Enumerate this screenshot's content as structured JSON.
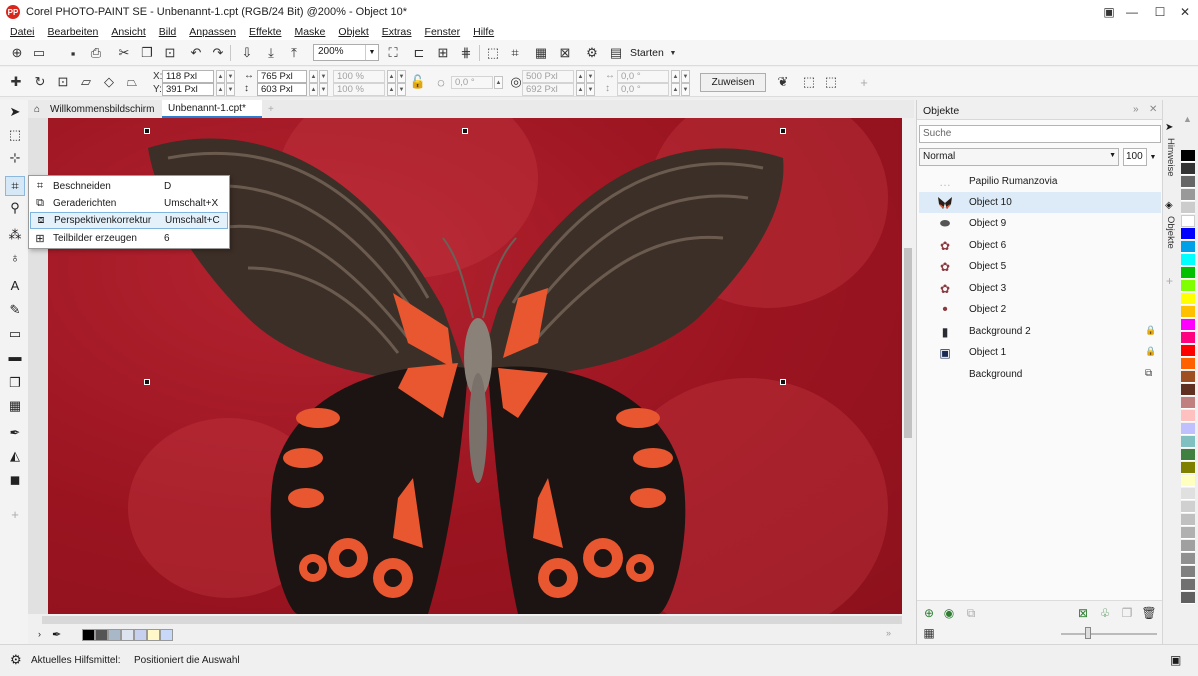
{
  "window": {
    "title": "Corel PHOTO-PAINT SE - Unbenannt-1.cpt (RGB/24 Bit) @200% - Object 10*",
    "app_icon_glyph": "PP",
    "minimize_glyph": "—",
    "maximize_glyph": "☐",
    "close_glyph": "✕"
  },
  "menu": [
    "Datei",
    "Bearbeiten",
    "Ansicht",
    "Bild",
    "Anpassen",
    "Effekte",
    "Maske",
    "Objekt",
    "Extras",
    "Fenster",
    "Hilfe"
  ],
  "toolbar": {
    "zoom_value": "200%",
    "zoom_arrow": "▼",
    "start_label": "Starten",
    "start_arrow": "▼"
  },
  "properties": {
    "x_label": "X:",
    "x_value": "118 Pxl",
    "y_label": "Y:",
    "y_value": "391 Pxl",
    "width_value": "765 Pxl",
    "height_value": "603 Pxl",
    "scale_w": "100 %",
    "scale_h": "100 %",
    "angle_value": "0,0 °",
    "center_x": "500 Pxl",
    "center_y": "692 Pxl",
    "skew_h": "0,0 °",
    "skew_v": "0,0 °",
    "assign_label": "Zuweisen"
  },
  "tabs": {
    "home_glyph": "⌂",
    "welcome": "Willkommensbildschirm",
    "document": "Unbenannt-1.cpt*",
    "add_glyph": "+"
  },
  "flyout": [
    {
      "label": "Beschneiden",
      "shortcut": "D",
      "icon": "crop-icon",
      "glyph": "⌗"
    },
    {
      "label": "Geraderichten",
      "shortcut": "Umschalt+X",
      "icon": "straighten-icon",
      "glyph": "⧉"
    },
    {
      "label": "Perspektivenkorrektur",
      "shortcut": "Umschalt+C",
      "icon": "perspective-icon",
      "glyph": "⧈"
    },
    {
      "label": "Teilbilder erzeugen",
      "shortcut": "6",
      "icon": "slice-icon",
      "glyph": "⊞"
    }
  ],
  "objects_panel": {
    "title": "Objekte",
    "search_placeholder": "Suche",
    "blend_mode": "Normal",
    "opacity": "100",
    "layers": [
      {
        "name": "Papilio Rumanzovia",
        "icon": "text-object-icon",
        "glyph": "…",
        "locked": false
      },
      {
        "name": "Object 10",
        "icon": "butterfly-thumb-icon",
        "glyph": "🦋",
        "locked": false,
        "selected": true
      },
      {
        "name": "Object 9",
        "icon": "object-thumb-icon",
        "glyph": "⬬",
        "locked": false
      },
      {
        "name": "Object 6",
        "icon": "object-thumb-icon",
        "glyph": "✿",
        "locked": false
      },
      {
        "name": "Object 5",
        "icon": "object-thumb-icon",
        "glyph": "✿",
        "locked": false
      },
      {
        "name": "Object 3",
        "icon": "object-thumb-icon",
        "glyph": "✿",
        "locked": false
      },
      {
        "name": "Object 2",
        "icon": "object-thumb-icon",
        "glyph": "•",
        "locked": false
      },
      {
        "name": "Background 2",
        "icon": "dark-thumb-icon",
        "glyph": "▮",
        "locked": true
      },
      {
        "name": "Object 1",
        "icon": "blue-thumb-icon",
        "glyph": "▣",
        "locked": true
      },
      {
        "name": "Background",
        "icon": "background-thumb-icon",
        "glyph": "",
        "locked": false
      }
    ],
    "lock_glyph": "🔒"
  },
  "side_tabs": [
    "Hinweise",
    "Objekte"
  ],
  "status": {
    "label": "Aktuelles Hilfsmittel:",
    "text": "Positioniert die Auswahl"
  },
  "colors": {
    "canvas_red": "#9a1420",
    "selection_blue": "#dcebf7",
    "palette": [
      "#000000",
      "#333333",
      "#666666",
      "#999999",
      "#cccccc",
      "#ffffff",
      "#0000ff",
      "#00a0e8",
      "#00ffff",
      "#00c000",
      "#80ff00",
      "#ffff00",
      "#ffc000",
      "#ff00ff",
      "#ff0080",
      "#ff0000",
      "#ff6000",
      "#a05020",
      "#603020",
      "#c08080",
      "#ffc0c0",
      "#c0c0ff",
      "#80c0c0",
      "#408040",
      "#808000",
      "#ffffc0"
    ]
  }
}
